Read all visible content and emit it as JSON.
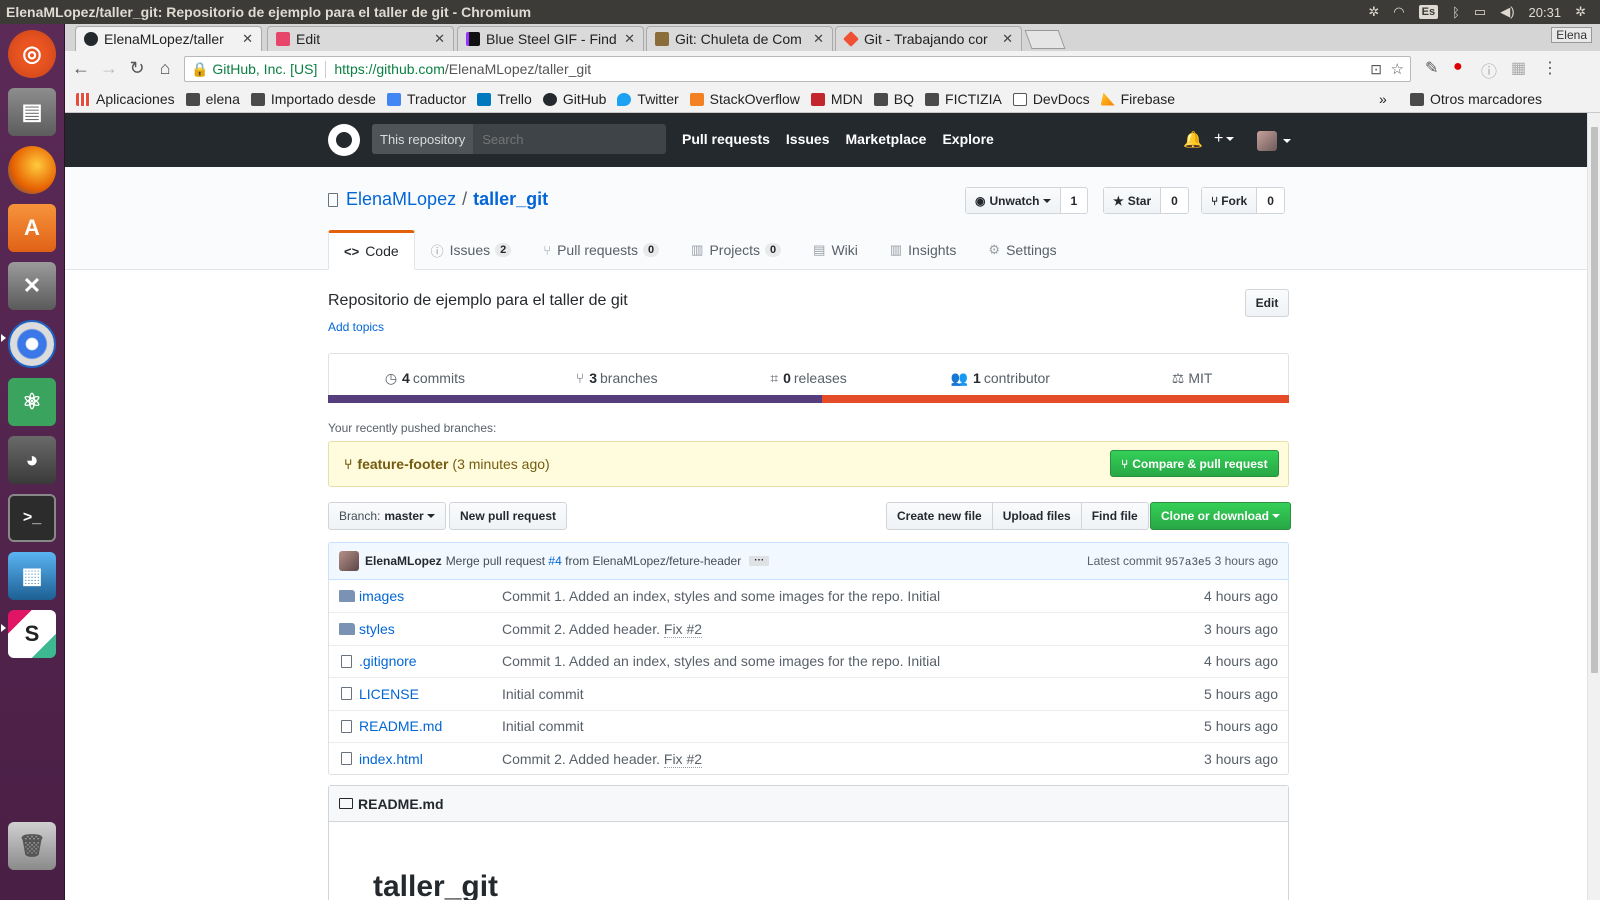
{
  "os": {
    "window_title": "ElenaMLopez/taller_git: Repositorio de ejemplo para el taller de git - Chromium",
    "keyboard": "Es",
    "clock": "20:31"
  },
  "launcher": {
    "apps": [
      "ubuntu-dash",
      "files",
      "firefox",
      "software-center",
      "system-settings",
      "chromium",
      "atom",
      "gimp",
      "terminal",
      "image-viewer",
      "slack",
      "trash"
    ]
  },
  "browser": {
    "tabs": [
      {
        "label": "ElenaMLopez/taller",
        "active": true,
        "favicon": "github-icon",
        "color": "#24292e"
      },
      {
        "label": "Edit",
        "active": false,
        "favicon": "s-icon",
        "color": "#e8456b"
      },
      {
        "label": "Blue Steel GIF - Find",
        "active": false,
        "favicon": "giphy-icon",
        "color": "#9933ff"
      },
      {
        "label": "Git: Chuleta de Com",
        "active": false,
        "favicon": "cheat-icon",
        "color": "#8a6d3b"
      },
      {
        "label": "Git - Trabajando cor",
        "active": false,
        "favicon": "git-icon",
        "color": "#f05033"
      }
    ],
    "profile": "Elena",
    "security_label": "GitHub, Inc. [US]",
    "url_scheme_host": "https://github.com",
    "url_path": "/ElenaMLopez/taller_git",
    "bookmarks": [
      {
        "label": "Aplicaciones",
        "icon": "apps-grid-icon",
        "color": "#e74c3c"
      },
      {
        "label": "elena",
        "icon": "folder-icon",
        "color": "#4a4a4a"
      },
      {
        "label": "Importado desde",
        "icon": "folder-icon",
        "color": "#4a4a4a"
      },
      {
        "label": "Traductor",
        "icon": "translate-icon",
        "color": "#4285f4"
      },
      {
        "label": "Trello",
        "icon": "trello-icon",
        "color": "#0079bf"
      },
      {
        "label": "GitHub",
        "icon": "github-icon",
        "color": "#24292e"
      },
      {
        "label": "Twitter",
        "icon": "twitter-icon",
        "color": "#1da1f2"
      },
      {
        "label": "StackOverflow",
        "icon": "stackoverflow-icon",
        "color": "#f48024"
      },
      {
        "label": "MDN",
        "icon": "mdn-icon",
        "color": "#c1272d"
      },
      {
        "label": "BQ",
        "icon": "folder-icon",
        "color": "#4a4a4a"
      },
      {
        "label": "FICTIZIA",
        "icon": "folder-icon",
        "color": "#4a4a4a"
      },
      {
        "label": "DevDocs",
        "icon": "devdocs-icon",
        "color": "#555555"
      },
      {
        "label": "Firebase",
        "icon": "firebase-icon",
        "color": "#ffca28"
      }
    ],
    "bookmarks_overflow": "»",
    "other_bookmarks": "Otros marcadores"
  },
  "github": {
    "search_scope": "This repository",
    "search_placeholder": "Search",
    "nav": [
      "Pull requests",
      "Issues",
      "Marketplace",
      "Explore"
    ],
    "repo": {
      "owner": "ElenaMLopez",
      "separator": "/",
      "name": "taller_git",
      "watch_label": "Unwatch",
      "watch_count": "1",
      "star_label": "Star",
      "star_count": "0",
      "fork_label": "Fork",
      "fork_count": "0"
    },
    "tabs": [
      {
        "label": "Code",
        "count": "",
        "icon": "code-icon",
        "selected": true
      },
      {
        "label": "Issues",
        "count": "2",
        "icon": "issue-icon",
        "selected": false
      },
      {
        "label": "Pull requests",
        "count": "0",
        "icon": "pull-request-icon",
        "selected": false
      },
      {
        "label": "Projects",
        "count": "0",
        "icon": "project-icon",
        "selected": false
      },
      {
        "label": "Wiki",
        "count": "",
        "icon": "wiki-icon",
        "selected": false
      },
      {
        "label": "Insights",
        "count": "",
        "icon": "graph-icon",
        "selected": false
      },
      {
        "label": "Settings",
        "count": "",
        "icon": "gear-icon",
        "selected": false
      }
    ],
    "description": "Repositorio de ejemplo para el taller de git",
    "edit_label": "Edit",
    "add_topics": "Add topics",
    "summary": [
      {
        "number": "4",
        "label": "commits",
        "icon": "history-icon"
      },
      {
        "number": "3",
        "label": "branches",
        "icon": "branch-icon"
      },
      {
        "number": "0",
        "label": "releases",
        "icon": "tag-icon"
      },
      {
        "number": "1",
        "label": "contributor",
        "icon": "people-icon"
      },
      {
        "number": "",
        "label": "MIT",
        "icon": "law-icon"
      }
    ],
    "languages": [
      {
        "color": "#563d7c",
        "share": 0.514
      },
      {
        "color": "#e34c26",
        "share": 0.486
      }
    ],
    "recent_label": "Your recently pushed branches:",
    "recent_branch": "feature-footer",
    "recent_time": "(3 minutes ago)",
    "compare_label": "Compare & pull request",
    "branch_prefix": "Branch:",
    "branch_name": "master",
    "new_pr_label": "New pull request",
    "file_actions": [
      "Create new file",
      "Upload files",
      "Find file"
    ],
    "clone_label": "Clone or download",
    "latest_commit": {
      "author": "ElenaMLopez",
      "message_pre": "Merge pull request",
      "pr_link": "#4",
      "message_post": "from ElenaMLopez/feture-header",
      "latest_label": "Latest commit",
      "sha": "957a3e5",
      "time": "3 hours ago"
    },
    "files": [
      {
        "name": "images",
        "type": "dir",
        "message": "Commit 1. Added an index, styles and some images for the repo. Initial",
        "issue_ref": "",
        "age": "4 hours ago"
      },
      {
        "name": "styles",
        "type": "dir",
        "message": "Commit 2. Added header.",
        "issue_ref": "Fix #2",
        "age": "3 hours ago"
      },
      {
        "name": ".gitignore",
        "type": "file",
        "message": "Commit 1. Added an index, styles and some images for the repo. Initial",
        "issue_ref": "",
        "age": "4 hours ago"
      },
      {
        "name": "LICENSE",
        "type": "file",
        "message": "Initial commit",
        "issue_ref": "",
        "age": "5 hours ago"
      },
      {
        "name": "README.md",
        "type": "file",
        "message": "Initial commit",
        "issue_ref": "",
        "age": "5 hours ago"
      },
      {
        "name": "index.html",
        "type": "file",
        "message": "Commit 2. Added header.",
        "issue_ref": "Fix #2",
        "age": "3 hours ago"
      }
    ],
    "readme_title": "README.md",
    "readme_h1": "taller_git"
  }
}
